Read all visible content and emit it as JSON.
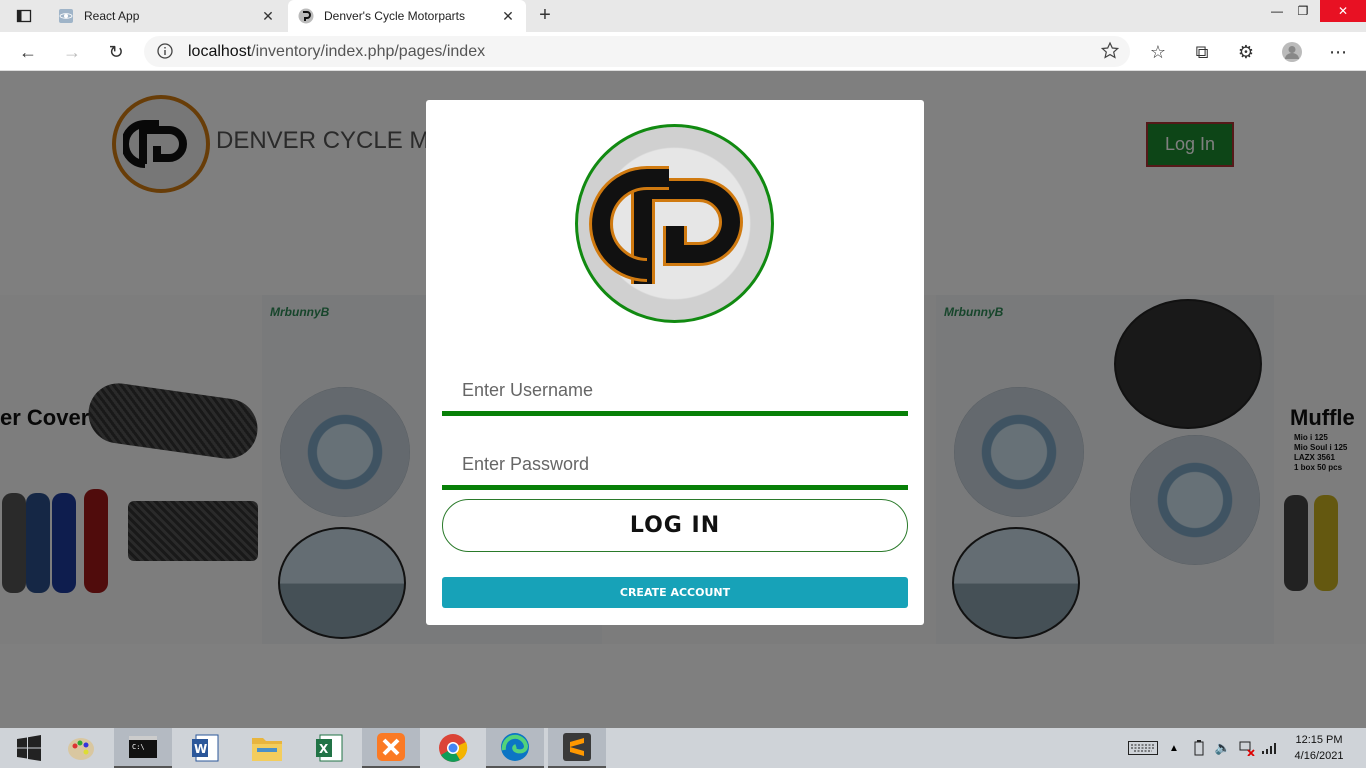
{
  "browser": {
    "tabs": [
      {
        "label": "React App",
        "active": false,
        "icon": "react-icon"
      },
      {
        "label": "Denver's Cycle Motorparts",
        "active": true,
        "icon": "site-favicon"
      }
    ],
    "address": {
      "host": "localhost",
      "path": "/inventory/index.php/pages/index"
    }
  },
  "site": {
    "title": "DENVER CYCLE M",
    "header_login": "Log In",
    "logo_letters": "CP",
    "banners": [
      {
        "title": "er Cover"
      },
      {
        "brand": "MrbunnyB"
      },
      {
        "brand": "MrbunnyB"
      },
      {
        "title": "Muffle",
        "specs": [
          "Mio i 125",
          "Mio Soul i 125",
          "LAZX 3561",
          "1 box 50 pcs"
        ]
      }
    ]
  },
  "modal": {
    "username_placeholder": "Enter Username",
    "password_placeholder": "Enter Password",
    "login_label": "LOG IN",
    "create_label": "CREATE ACCOUNT"
  },
  "taskbar": {
    "time": "12:15 PM",
    "date": "4/16/2021",
    "apps": [
      "start-icon",
      "paint-icon",
      "cmd-icon",
      "word-icon",
      "explorer-icon",
      "excel-icon",
      "xampp-icon",
      "chrome-icon",
      "edge-icon",
      "sublime-icon"
    ]
  },
  "colors": {
    "accent_green": "#078007",
    "create_button": "#17a2b8",
    "logo_orange": "#d07a10"
  }
}
